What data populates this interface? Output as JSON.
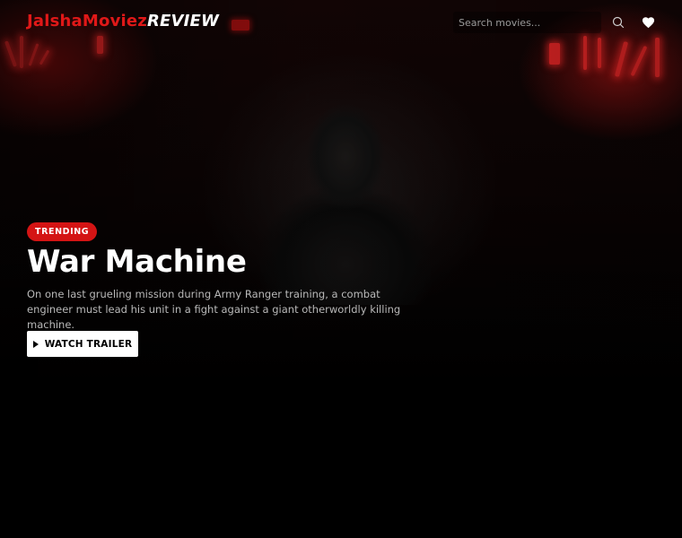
{
  "header": {
    "logo_brand": "JalshaMoviez",
    "logo_suffix": "REVIEW",
    "search_placeholder": "Search movies...",
    "icons": [
      "search-icon",
      "heart-icon"
    ]
  },
  "hero": {
    "badge": "TRENDING",
    "title": "War Machine",
    "description": "On one last grueling mission during Army Ranger training, a combat engineer must lead his unit in a fight against a giant otherworldly killing machine.",
    "cta_label": "WATCH TRAILER",
    "cta_icon": "play-icon"
  },
  "colors": {
    "accent": "#d41414",
    "background": "#000000",
    "button_bg": "#ffffff"
  }
}
